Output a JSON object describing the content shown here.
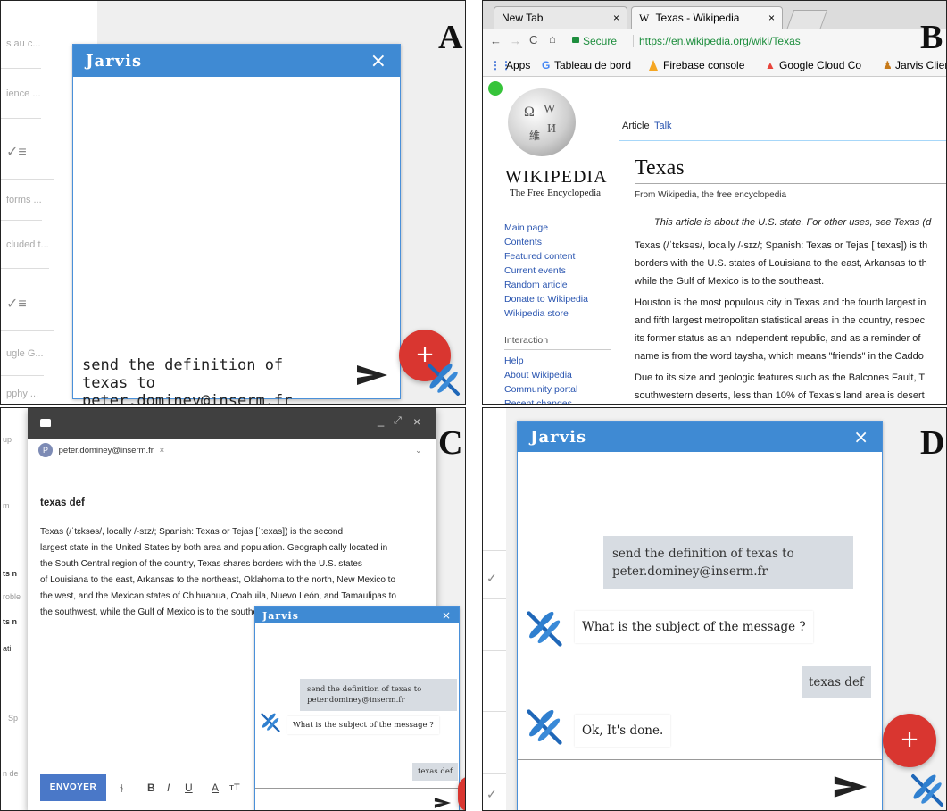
{
  "panels": {
    "a": {
      "letter": "A",
      "bg_rows": [
        "s au c...",
        "ience ...",
        "",
        "forms ...",
        "cluded t...",
        "",
        "ugle G...",
        "pphy ..."
      ],
      "jarvis_title": "Jarvis",
      "close_glyph": "×",
      "input_value": "send the definition of texas to peter.dominey@inserm.fr",
      "fab_glyph": "+"
    },
    "b": {
      "letter": "B",
      "tabs": [
        "New Tab",
        "Texas - Wikipedia"
      ],
      "tab_close": "×",
      "tab_icon": "W",
      "secure_label": "Secure",
      "url": "https://en.wikipedia.org/wiki/Texas",
      "bookmarks": [
        "Apps",
        "Tableau de bord",
        "Firebase console",
        "Google Cloud Co",
        "Jarvis Clien"
      ],
      "wiki_wordmark": "WIKIPEDIA",
      "wiki_tagline": "The Free Encyclopedia",
      "page_tabs": [
        "Article",
        "Talk"
      ],
      "page_title": "Texas",
      "from_line": "From Wikipedia, the free encyclopedia",
      "hatnote": "This article is about the U.S. state. For other uses, see Texas (d",
      "nav_main": [
        "Main page",
        "Contents",
        "Featured content",
        "Current events",
        "Random article",
        "Donate to Wikipedia",
        "Wikipedia store"
      ],
      "interaction_heading": "Interaction",
      "nav_interaction": [
        "Help",
        "About Wikipedia",
        "Community portal",
        "Recent changes"
      ],
      "para1": [
        "Texas (/ˈtɛksəs/, locally /-sɪz/; Spanish: Texas or Tejas [ˈtexas]) is th",
        "borders with the U.S. states of Louisiana to the east, Arkansas to th",
        "while the Gulf of Mexico is to the southeast."
      ],
      "para2": [
        "Houston is the most populous city in Texas and the fourth largest in",
        "and fifth largest metropolitan statistical areas in the country, respec",
        "its former status as an independent republic, and as a reminder of",
        "name is from the word taysha, which means \"friends\" in the Caddo"
      ],
      "para3": [
        "Due to its size and geologic features such as the Balcones Fault, T",
        "southwestern deserts, less than 10% of Texas's land area is desert"
      ]
    },
    "c": {
      "letter": "C",
      "window_controls": [
        "_",
        "⤢",
        "×"
      ],
      "recipient": "peter.dominey@inserm.fr",
      "recipient_initial": "P",
      "subject": "texas def",
      "body_lines": [
        "Texas (/ˈtɛksəs/, locally /-sɪz/; Spanish: Texas or Tejas [ˈtexas]) is the second",
        "largest state in the United States by both area and population. Geographically located in",
        "the South Central region of the country, Texas shares borders with the U.S. states",
        "of Louisiana to the east, Arkansas to the northeast, Oklahoma to the north, New Mexico to",
        "the west, and the Mexican states of Chihuahua, Coahuila, Nuevo León, and Tamaulipas to",
        "the southwest, while the Gulf of Mexico is to the southeast."
      ],
      "send_button": "ENVOYER",
      "format_glyphs": [
        "B",
        "I",
        "U",
        "A",
        "тT"
      ],
      "bg_rows": [
        "up",
        "m",
        "",
        "ts n",
        "roble",
        "ts n",
        "ati",
        "",
        "Sp",
        "",
        "n de"
      ],
      "jarvis_title": "Jarvis",
      "close_glyph": "×",
      "messages": [
        {
          "from": "user",
          "text": "send the definition of texas to peter.dominey@inserm.fr"
        },
        {
          "from": "bot",
          "text": "What is the subject of the message ?"
        },
        {
          "from": "user",
          "text": "texas def"
        }
      ]
    },
    "d": {
      "letter": "D",
      "jarvis_title": "Jarvis",
      "close_glyph": "×",
      "messages": [
        {
          "from": "user",
          "text": "send the definition of texas to peter.dominey@inserm.fr"
        },
        {
          "from": "bot",
          "text": "What is the subject of the message ?"
        },
        {
          "from": "user",
          "text": "texas def"
        },
        {
          "from": "bot",
          "text": "Ok, It's done."
        }
      ],
      "input_value": "",
      "fab_glyph": "+"
    }
  }
}
